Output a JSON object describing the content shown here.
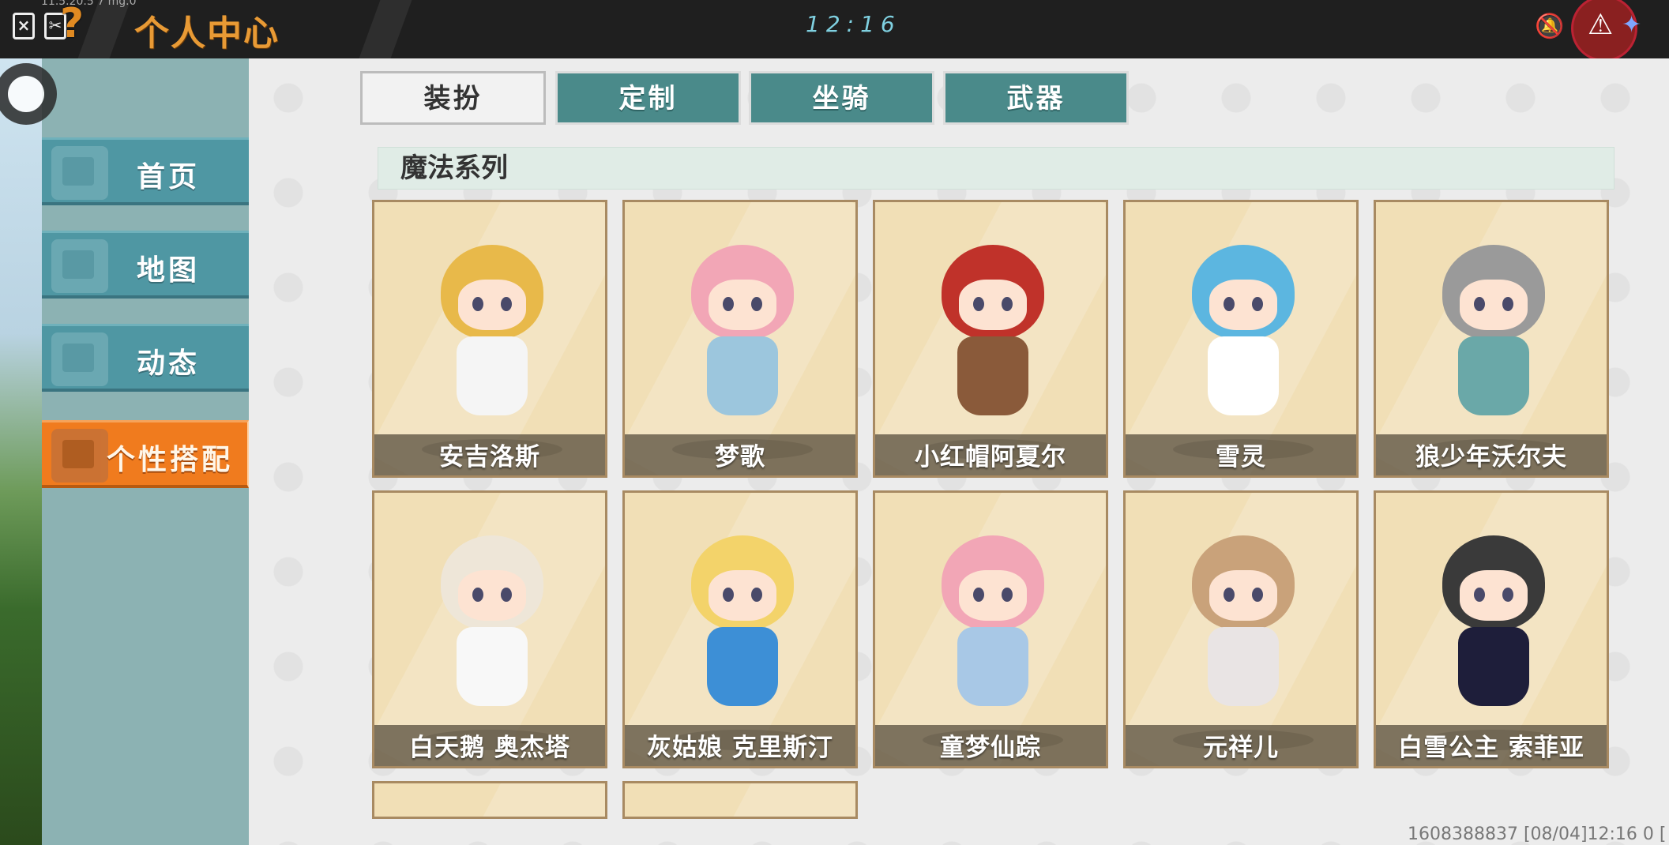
{
  "status_bar": {
    "version_text": "11.5.20.5 7 mg.0",
    "clock": "12:16"
  },
  "header": {
    "title": "个人中心"
  },
  "sidebar": {
    "items": [
      {
        "label": "首页",
        "icon": "home-icon"
      },
      {
        "label": "地图",
        "icon": "map-icon"
      },
      {
        "label": "动态",
        "icon": "bell-icon"
      },
      {
        "label": "个性搭配",
        "icon": "outfit-icon",
        "active": true
      }
    ]
  },
  "tabs": [
    {
      "label": "装扮",
      "active": true
    },
    {
      "label": "定制",
      "active": false
    },
    {
      "label": "坐骑",
      "active": false
    },
    {
      "label": "武器",
      "active": false
    }
  ],
  "section": {
    "title": "魔法系列"
  },
  "cards": [
    {
      "name": "安吉洛斯",
      "hair": "#e8b94a",
      "dress": "#f5f5f5"
    },
    {
      "name": "梦歌",
      "hair": "#f2a6b6",
      "dress": "#9cc6dd"
    },
    {
      "name": "小红帽阿夏尔",
      "hair": "#c0322a",
      "dress": "#8a5a3a"
    },
    {
      "name": "雪灵",
      "hair": "#5cb6e0",
      "dress": "#ffffff"
    },
    {
      "name": "狼少年沃尔夫",
      "hair": "#9a9a9a",
      "dress": "#6aa8a8"
    },
    {
      "name": "白天鹅 奥杰塔",
      "hair": "#eee6d8",
      "dress": "#f8f8f8"
    },
    {
      "name": "灰姑娘 克里斯汀",
      "hair": "#f3d36a",
      "dress": "#3d8fd6"
    },
    {
      "name": "童梦仙踪",
      "hair": "#f2a6b6",
      "dress": "#a8c8e6"
    },
    {
      "name": "元祥儿",
      "hair": "#c9a27a",
      "dress": "#e9e4e4"
    },
    {
      "name": "白雪公主 索菲亚",
      "hair": "#3a3a3a",
      "dress": "#1e1e3a"
    }
  ],
  "footer": {
    "id_text": "1608388837  [08/04]12:16 0  ["
  },
  "colors": {
    "accent_orange": "#f07b1e",
    "teal": "#4a8a8a",
    "card_bg": "#f1dfb6"
  }
}
